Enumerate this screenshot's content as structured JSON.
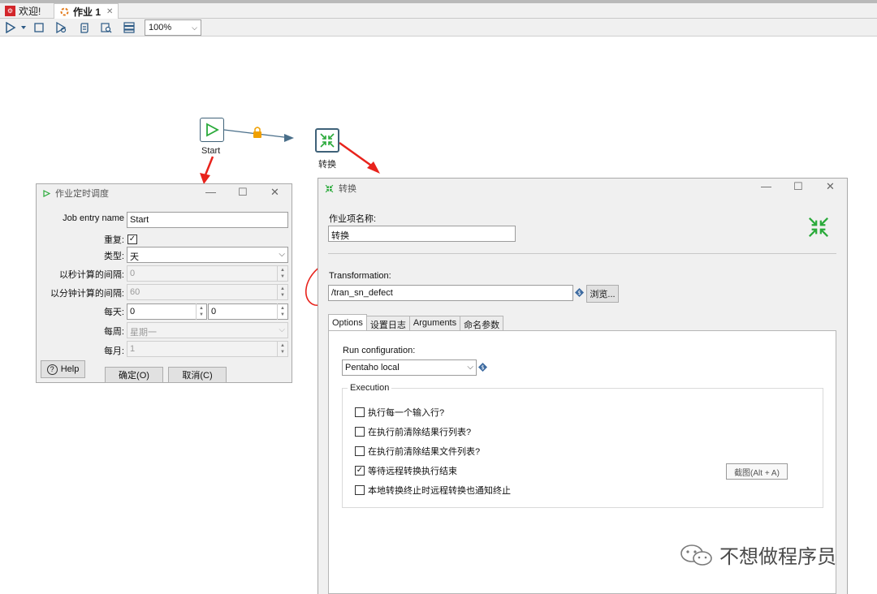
{
  "tabs": [
    {
      "label": "欢迎!",
      "icon": "pentaho-welcome-icon"
    },
    {
      "label": "作业 1",
      "icon": "job-icon",
      "active": true
    }
  ],
  "toolbar": {
    "zoom": "100%"
  },
  "canvas": {
    "nodes": [
      {
        "label": "Start",
        "icon": "start-play-icon"
      },
      {
        "label": "转换",
        "icon": "transformation-icon"
      }
    ]
  },
  "schedule_dialog": {
    "title": "作业定时调度",
    "job_entry_name_label": "Job entry name",
    "job_entry_name_value": "Start",
    "repeat_label": "重复:",
    "repeat_checked": true,
    "type_label": "类型:",
    "type_value": "天",
    "seconds_label": "以秒计算的间隔:",
    "seconds_value": "0",
    "minutes_label": "以分钟计算的间隔:",
    "minutes_value": "60",
    "daily_label": "每天:",
    "daily_hour": "0",
    "daily_minute": "0",
    "weekly_label": "每周:",
    "weekly_value": "星期一",
    "monthly_label": "每月:",
    "monthly_value": "1",
    "help_label": "Help",
    "ok_label": "确定(O)",
    "cancel_label": "取消(C)"
  },
  "transform_dialog": {
    "title": "转换",
    "entry_name_label": "作业项名称:",
    "entry_name_value": "转换",
    "transformation_label": "Transformation:",
    "transformation_value": "/tran_sn_defect",
    "browse_label": "浏览...",
    "tabs": [
      "Options",
      "设置日志",
      "Arguments",
      "命名参数"
    ],
    "run_config_label": "Run configuration:",
    "run_config_value": "Pentaho local",
    "execution_label": "Execution",
    "options": [
      {
        "label": "执行每一个输入行?",
        "checked": false
      },
      {
        "label": "在执行前清除结果行列表?",
        "checked": false
      },
      {
        "label": "在执行前清除结果文件列表?",
        "checked": false
      },
      {
        "label": "等待远程转换执行结束",
        "checked": true
      },
      {
        "label": "本地转换终止时远程转换也通知终止",
        "checked": false
      }
    ],
    "screenshot_hint": "截图(Alt + A)"
  },
  "watermark": "不想做程序员",
  "colors": {
    "annotation_red": "#e8231c",
    "accent_green": "#2aaa3a",
    "node_border": "#3f6279",
    "hop_blue": "#4a6f8a",
    "lock_orange": "#f0a000"
  }
}
